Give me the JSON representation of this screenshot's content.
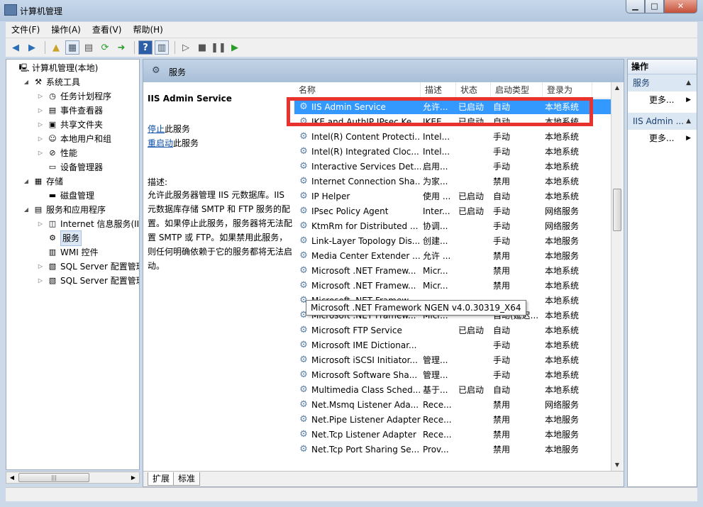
{
  "window": {
    "title": "计算机管理",
    "min": "▁",
    "max": "□",
    "close": "✕"
  },
  "menu": [
    "文件(F)",
    "操作(A)",
    "查看(V)",
    "帮助(H)"
  ],
  "tree": [
    {
      "label": "计算机管理(本地)",
      "icon": "computer-icon",
      "level": 0,
      "exp": ""
    },
    {
      "label": "系统工具",
      "icon": "tools-icon",
      "level": 1,
      "exp": "◢"
    },
    {
      "label": "任务计划程序",
      "icon": "clock-icon",
      "level": 2,
      "exp": "▷"
    },
    {
      "label": "事件查看器",
      "icon": "event-viewer-icon",
      "level": 2,
      "exp": "▷"
    },
    {
      "label": "共享文件夹",
      "icon": "shared-folder-icon",
      "level": 2,
      "exp": "▷"
    },
    {
      "label": "本地用户和组",
      "icon": "users-icon",
      "level": 2,
      "exp": "▷"
    },
    {
      "label": "性能",
      "icon": "performance-icon",
      "level": 2,
      "exp": "▷"
    },
    {
      "label": "设备管理器",
      "icon": "device-manager-icon",
      "level": 2,
      "exp": ""
    },
    {
      "label": "存储",
      "icon": "storage-icon",
      "level": 1,
      "exp": "◢"
    },
    {
      "label": "磁盘管理",
      "icon": "disk-icon",
      "level": 2,
      "exp": ""
    },
    {
      "label": "服务和应用程序",
      "icon": "services-apps-icon",
      "level": 1,
      "exp": "◢"
    },
    {
      "label": "Internet 信息服务(IIS)管",
      "icon": "iis-icon",
      "level": 2,
      "exp": "▷"
    },
    {
      "label": "服务",
      "icon": "services-icon",
      "level": 2,
      "exp": "",
      "selected": true
    },
    {
      "label": "WMI 控件",
      "icon": "wmi-icon",
      "level": 2,
      "exp": ""
    },
    {
      "label": "SQL Server 配置管理器",
      "icon": "sql-config-icon",
      "level": 2,
      "exp": "▷"
    },
    {
      "label": "SQL Server 配置管理器",
      "icon": "sql-config-icon",
      "level": 2,
      "exp": "▷"
    }
  ],
  "center": {
    "header": "服务",
    "service_name": "IIS Admin Service",
    "stop_link": "停止",
    "stop_suffix": "此服务",
    "restart_link": "重启动",
    "restart_suffix": "此服务",
    "desc_label": "描述:",
    "description": "允许此服务器管理 IIS 元数据库。IIS 元数据库存储 SMTP 和 FTP 服务的配置。如果停止此服务，服务器将无法配置 SMTP 或 FTP。如果禁用此服务，则任何明确依赖于它的服务都将无法启动。",
    "columns": [
      "名称",
      "描述",
      "状态",
      "启动类型",
      "登录为"
    ],
    "rows": [
      {
        "name": "IIS Admin Service",
        "desc": "允许...",
        "status": "已启动",
        "startup": "自动",
        "logon": "本地系统",
        "selected": true
      },
      {
        "name": "IKE and AuthIP IPsec Ke...",
        "desc": "IKEE...",
        "status": "已启动",
        "startup": "自动",
        "logon": "本地系统"
      },
      {
        "name": "Intel(R) Content Protecti...",
        "desc": "Intel...",
        "status": "",
        "startup": "手动",
        "logon": "本地系统"
      },
      {
        "name": "Intel(R) Integrated Cloc...",
        "desc": "Intel...",
        "status": "",
        "startup": "手动",
        "logon": "本地系统"
      },
      {
        "name": "Interactive Services Det...",
        "desc": "启用...",
        "status": "",
        "startup": "手动",
        "logon": "本地系统"
      },
      {
        "name": "Internet Connection Sha...",
        "desc": "为家...",
        "status": "",
        "startup": "禁用",
        "logon": "本地系统"
      },
      {
        "name": "IP Helper",
        "desc": "使用 ...",
        "status": "已启动",
        "startup": "自动",
        "logon": "本地系统"
      },
      {
        "name": "IPsec Policy Agent",
        "desc": "Inter...",
        "status": "已启动",
        "startup": "手动",
        "logon": "网络服务"
      },
      {
        "name": "KtmRm for Distributed ...",
        "desc": "协调...",
        "status": "",
        "startup": "手动",
        "logon": "网络服务"
      },
      {
        "name": "Link-Layer Topology Dis...",
        "desc": "创建...",
        "status": "",
        "startup": "手动",
        "logon": "本地服务"
      },
      {
        "name": "Media Center Extender ...",
        "desc": "允许 ...",
        "status": "",
        "startup": "禁用",
        "logon": "本地服务"
      },
      {
        "name": "Microsoft .NET Framew...",
        "desc": "Micr...",
        "status": "",
        "startup": "禁用",
        "logon": "本地系统"
      },
      {
        "name": "Microsoft .NET Framew...",
        "desc": "Micr...",
        "status": "",
        "startup": "禁用",
        "logon": "本地系统"
      },
      {
        "name": "Microsoft .NET Framew...",
        "desc": "",
        "status": "",
        "startup": "",
        "logon": "本地系统"
      },
      {
        "name": "Microsoft .NET Framew...",
        "desc": "Micr...",
        "status": "",
        "startup": "自动(延迟...",
        "logon": "本地系统"
      },
      {
        "name": "Microsoft FTP Service",
        "desc": "",
        "status": "已启动",
        "startup": "自动",
        "logon": "本地系统"
      },
      {
        "name": "Microsoft IME Dictionar...",
        "desc": "",
        "status": "",
        "startup": "手动",
        "logon": "本地系统"
      },
      {
        "name": "Microsoft iSCSI Initiator...",
        "desc": "管理...",
        "status": "",
        "startup": "手动",
        "logon": "本地系统"
      },
      {
        "name": "Microsoft Software Sha...",
        "desc": "管理...",
        "status": "",
        "startup": "手动",
        "logon": "本地系统"
      },
      {
        "name": "Multimedia Class Sched...",
        "desc": "基于...",
        "status": "已启动",
        "startup": "自动",
        "logon": "本地系统"
      },
      {
        "name": "Net.Msmq Listener Ada...",
        "desc": "Rece...",
        "status": "",
        "startup": "禁用",
        "logon": "网络服务"
      },
      {
        "name": "Net.Pipe Listener Adapter",
        "desc": "Rece...",
        "status": "",
        "startup": "禁用",
        "logon": "本地服务"
      },
      {
        "name": "Net.Tcp Listener Adapter",
        "desc": "Rece...",
        "status": "",
        "startup": "禁用",
        "logon": "本地服务"
      },
      {
        "name": "Net.Tcp Port Sharing Se...",
        "desc": "Prov...",
        "status": "",
        "startup": "禁用",
        "logon": "本地服务"
      }
    ],
    "tooltip": "Microsoft .NET Framework NGEN v4.0.30319_X64",
    "tabs": [
      "扩展",
      "标准"
    ]
  },
  "actions": {
    "title": "操作",
    "section1": "服务",
    "more1": "更多...",
    "section2": "IIS Admin ...",
    "more2": "更多..."
  },
  "colors": {
    "selection": "#3399ff",
    "highlight_box": "#e8322e",
    "link": "#0b4ea8"
  }
}
